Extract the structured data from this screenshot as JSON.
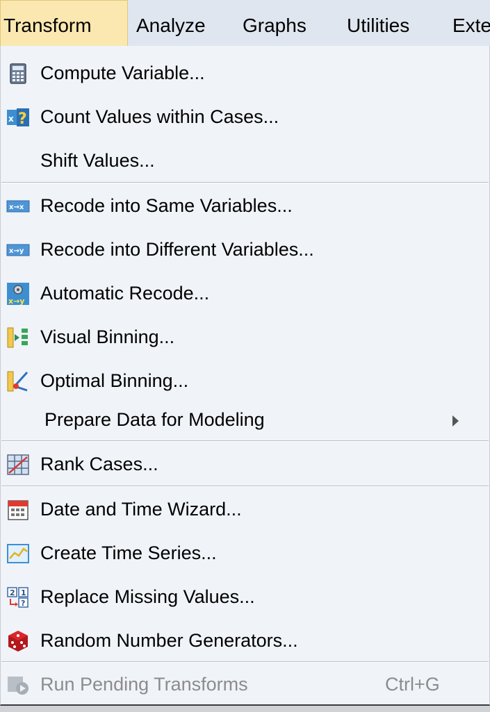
{
  "menubar": {
    "transform": "Transform",
    "analyze": "Analyze",
    "graphs": "Graphs",
    "utilities": "Utilities",
    "extensions": "Exte"
  },
  "menu": {
    "compute_variable": "Compute Variable...",
    "count_values": "Count Values within Cases...",
    "shift_values": "Shift Values...",
    "recode_same": "Recode into Same Variables...",
    "recode_different": "Recode into Different Variables...",
    "automatic_recode": "Automatic Recode...",
    "visual_binning": "Visual Binning...",
    "optimal_binning": "Optimal Binning...",
    "prepare_data": "Prepare Data for Modeling",
    "rank_cases": "Rank Cases...",
    "date_time_wizard": "Date and Time Wizard...",
    "create_time_series": "Create Time Series...",
    "replace_missing": "Replace Missing Values...",
    "random_number_generators": "Random Number Generators...",
    "run_pending": "Run Pending Transforms",
    "run_pending_shortcut": "Ctrl+G"
  },
  "icons": {
    "compute_variable": "calculator-icon",
    "count_values": "count-values-icon",
    "recode_same": "recode-same-icon",
    "recode_different": "recode-different-icon",
    "automatic_recode": "automatic-recode-icon",
    "visual_binning": "visual-binning-icon",
    "optimal_binning": "optimal-binning-icon",
    "rank_cases": "rank-cases-icon",
    "date_time_wizard": "calendar-icon",
    "create_time_series": "time-series-icon",
    "replace_missing": "replace-missing-icon",
    "random_number_generators": "dice-icon",
    "run_pending": "run-pending-icon"
  },
  "colors": {
    "active_menu_bg": "#fbe8b0",
    "menu_bg": "#f0f3f8",
    "disabled_text": "#8c8c8c"
  }
}
